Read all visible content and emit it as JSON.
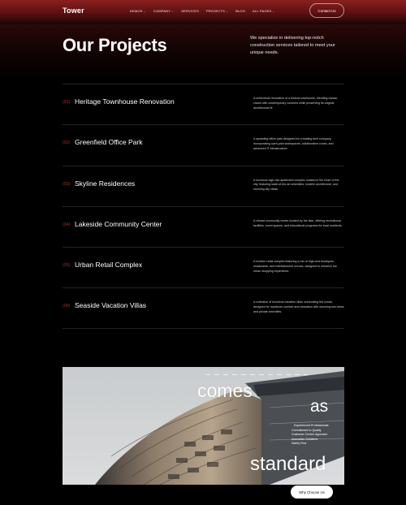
{
  "header": {
    "logo": "Tower",
    "nav": [
      {
        "label": "DEMOS",
        "has_dropdown": true
      },
      {
        "label": "COMPANY",
        "has_dropdown": true
      },
      {
        "label": "SERVICES",
        "has_dropdown": false
      },
      {
        "label": "PROJECTS",
        "has_dropdown": true
      },
      {
        "label": "BLOG",
        "has_dropdown": false
      },
      {
        "label": "ALL PAGES",
        "has_dropdown": true
      }
    ],
    "contact_label": "Contact Us"
  },
  "hero": {
    "title": "Our Projects",
    "intro": "We specialize in delivering top-notch construction services tailored to meet your unique needs."
  },
  "projects": [
    {
      "num": "(01)",
      "name": "Heritage Townhouse Renovation",
      "desc": "A meticulous renovation of a historic townhouse, blending classic charm with contemporary comforts while preserving its original architectural fe"
    },
    {
      "num": "(02)",
      "name": "Greenfield Office Park",
      "desc": "A sprawling office park designed for a leading tech company, incorporating open-plan workspaces, collaborative zones, and advanced IT infrastructure."
    },
    {
      "num": "(03)",
      "name": "Skyline Residences",
      "desc": "A luxurious high-rise apartment complex located in the heart of the city, featuring state-of-the-art amenities, modern architecture, and stunning city views."
    },
    {
      "num": "(04)",
      "name": "Lakeside Community Center",
      "desc": "A vibrant community center located by the lake, offering recreational facilities, event spaces, and educational programs for local residents."
    },
    {
      "num": "(05)",
      "name": "Urban Retail Complex",
      "desc": "A modern retail complex featuring a mix of high-end boutiques, restaurants, and entertainment venues, designed to enhance the urban shopping experience."
    },
    {
      "num": "(06)",
      "name": "Seaside Vacation Villas",
      "desc": "A collection of luxurious vacation villas overlooking the ocean, designed for maximum comfort and relaxation with stunning sea views and private amenities."
    }
  ],
  "feature": {
    "word_1": "comes",
    "word_2": "as",
    "word_3": "standard",
    "values": [
      "Experienced Professionals",
      "Commitment to Quality",
      "Customer-Centric Approach",
      "Innovative Solutions",
      "Safety First"
    ]
  },
  "cta": {
    "why_label": "Why Choose Us"
  },
  "colors": {
    "accent": "#b83030",
    "header_red": "#8a1f1f",
    "background": "#000000"
  },
  "icons": {
    "dropdown": "chevron-down-icon"
  }
}
